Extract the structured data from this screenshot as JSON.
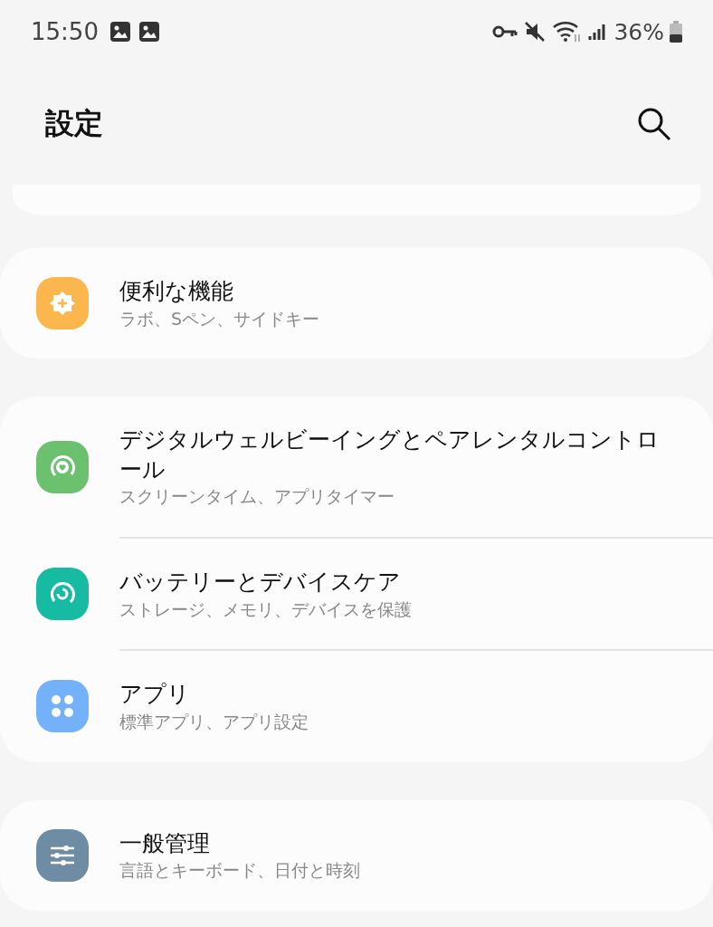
{
  "status_bar": {
    "time": "15:50",
    "battery_percent": "36%"
  },
  "header": {
    "title": "設定"
  },
  "groups": [
    {
      "items": [
        {
          "title": "便利な機能",
          "subtitle": "ラボ、Sペン、サイドキー",
          "kind": "gear",
          "color": "#fbb74d"
        }
      ]
    },
    {
      "items": [
        {
          "title": "デジタルウェルビーイングとペアレンタルコントロール",
          "subtitle": "スクリーンタイム、アプリタイマー",
          "kind": "heart",
          "color": "#6cc16e"
        },
        {
          "title": "バッテリーとデバイスケア",
          "subtitle": "ストレージ、メモリ、デバイスを保護",
          "kind": "care",
          "color": "#16bba2"
        },
        {
          "title": "アプリ",
          "subtitle": "標準アプリ、アプリ設定",
          "kind": "apps",
          "color": "#73b2fb"
        }
      ]
    },
    {
      "items": [
        {
          "title": "一般管理",
          "subtitle": "言語とキーボード、日付と時刻",
          "kind": "sliders",
          "color": "#6e8ca3"
        }
      ]
    }
  ]
}
